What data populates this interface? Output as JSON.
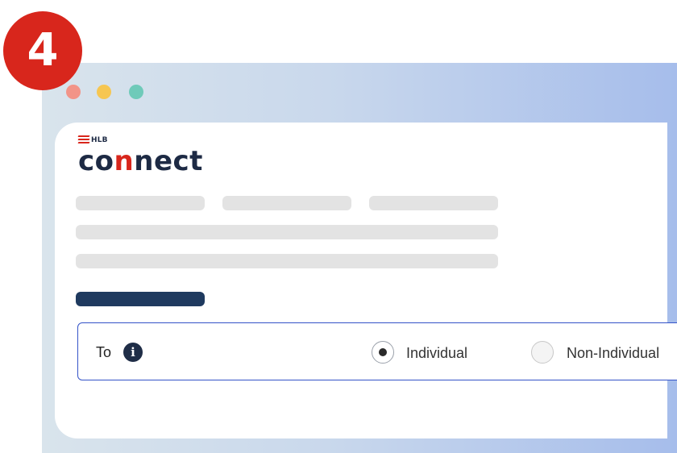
{
  "step_badge": {
    "number": "4"
  },
  "window_controls": [
    {
      "name": "close",
      "color": "#f29488"
    },
    {
      "name": "minimize",
      "color": "#f6c651"
    },
    {
      "name": "maximize",
      "color": "#6fcab9"
    }
  ],
  "logo": {
    "brand": "HLB",
    "product": "CONNECT"
  },
  "transfer_form": {
    "to_label": "To",
    "info_icon": "info-icon",
    "options": [
      {
        "label": "Individual",
        "selected": true
      },
      {
        "label": "Non-Individual",
        "selected": false
      }
    ]
  },
  "colors": {
    "badge": "#d8261c",
    "brand_navy": "#1d2a44",
    "brand_red": "#d8261c",
    "field_border": "#3453c8",
    "placeholder": "#e3e3e3",
    "button_placeholder": "#1f3a5f"
  }
}
